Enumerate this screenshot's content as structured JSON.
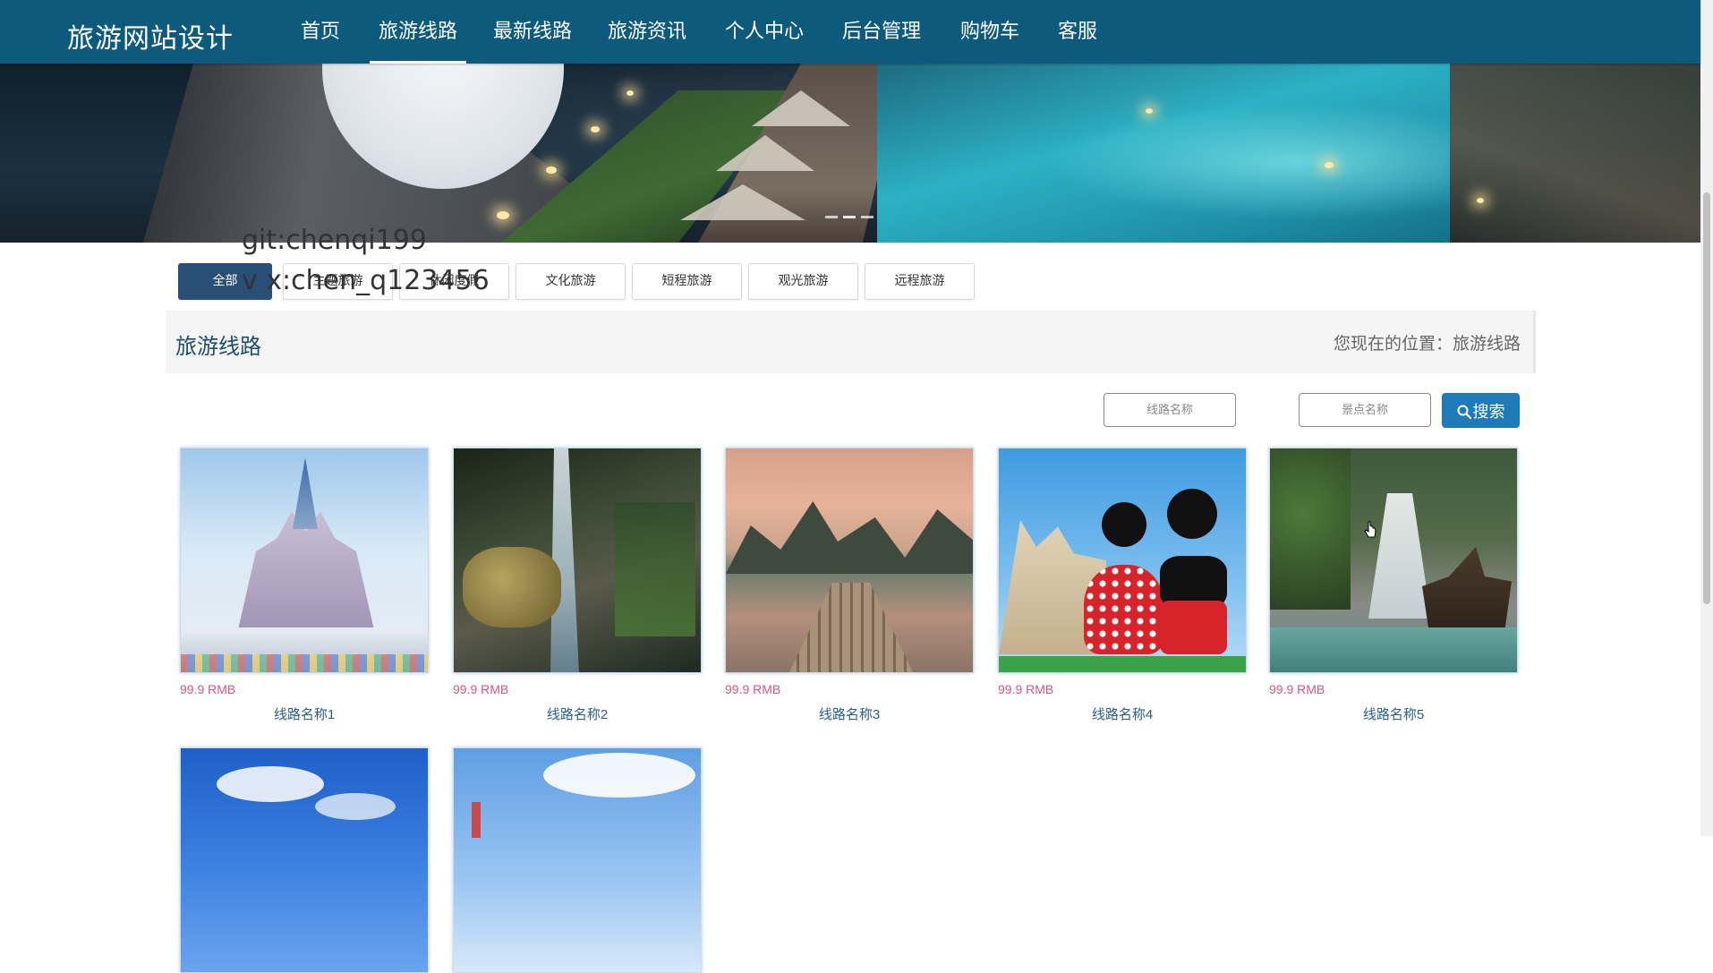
{
  "nav": {
    "brand": "旅游网站设计",
    "items": [
      {
        "label": "首页",
        "active": false
      },
      {
        "label": "旅游线路",
        "active": true
      },
      {
        "label": "最新线路",
        "active": false
      },
      {
        "label": "旅游资讯",
        "active": false
      },
      {
        "label": "个人中心",
        "active": false
      },
      {
        "label": "后台管理",
        "active": false
      },
      {
        "label": "购物车",
        "active": false
      },
      {
        "label": "客服",
        "active": false
      }
    ]
  },
  "watermark": {
    "line1": "git:chenqi199",
    "line2": "v x:chen_q123456"
  },
  "categories": [
    {
      "label": "全部",
      "active": true
    },
    {
      "label": "主题旅游",
      "active": false
    },
    {
      "label": "休闲度假",
      "active": false
    },
    {
      "label": "文化旅游",
      "active": false
    },
    {
      "label": "短程旅游",
      "active": false
    },
    {
      "label": "观光旅游",
      "active": false
    },
    {
      "label": "远程旅游",
      "active": false
    }
  ],
  "page": {
    "title": "旅游线路",
    "breadcrumb": "您现在的位置：旅游线路"
  },
  "search": {
    "route_placeholder": "线路名称",
    "spot_placeholder": "景点名称",
    "button_label": "搜索"
  },
  "routes": [
    {
      "price": "99.9 RMB",
      "name": "线路名称1",
      "image": "castle-photo"
    },
    {
      "price": "99.9 RMB",
      "name": "线路名称2",
      "image": "waterfall-photo"
    },
    {
      "price": "99.9 RMB",
      "name": "线路名称3",
      "image": "river-raft-photo"
    },
    {
      "price": "99.9 RMB",
      "name": "线路名称4",
      "image": "mickey-minnie-photo"
    },
    {
      "price": "99.9 RMB",
      "name": "线路名称5",
      "image": "pirate-ship-photo"
    },
    {
      "image": "blue-sky-photo"
    },
    {
      "image": "sky-clouds-photo"
    }
  ],
  "colors": {
    "nav_bg": "#0d5a7c",
    "active_category": "#2a4f77",
    "search_button": "#1f7ab8",
    "price": "#d9567f",
    "route_name": "#2a5f8a"
  }
}
